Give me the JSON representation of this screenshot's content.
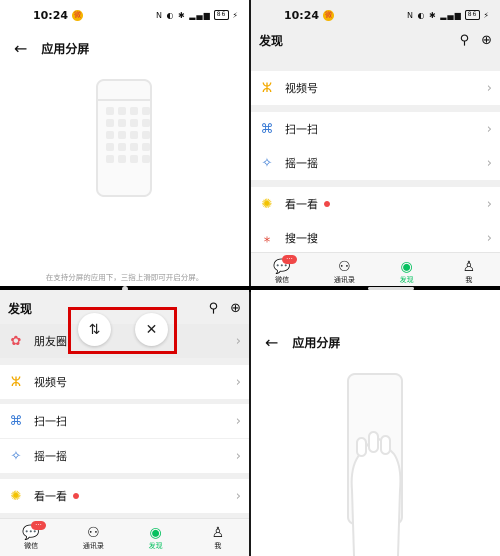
{
  "status": {
    "time": "10:24",
    "battery": "86",
    "weibo_badge": "微"
  },
  "split_screen": {
    "title": "应用分屏",
    "hint": "在支持分屏的应用下，三指上滑即可开启分屏。"
  },
  "discover": {
    "title": "发现",
    "items": [
      {
        "label": "朋友圈",
        "icon": "moments-icon"
      },
      {
        "label": "视频号",
        "icon": "channels-icon"
      },
      {
        "label": "扫一扫",
        "icon": "scan-icon"
      },
      {
        "label": "摇一摇",
        "icon": "shake-icon"
      },
      {
        "label": "看一看",
        "icon": "top-stories-icon"
      },
      {
        "label": "搜一搜",
        "icon": "search-icon"
      }
    ]
  },
  "tabs": [
    {
      "label": "微信",
      "badge": "···"
    },
    {
      "label": "通讯录"
    },
    {
      "label": "发现"
    },
    {
      "label": "我"
    }
  ],
  "controls": {
    "swap_glyph": "⇅",
    "close_glyph": "✕"
  },
  "colors": {
    "accent": "#07c160",
    "highlight_box": "#d80000",
    "badge": "#f04848"
  }
}
